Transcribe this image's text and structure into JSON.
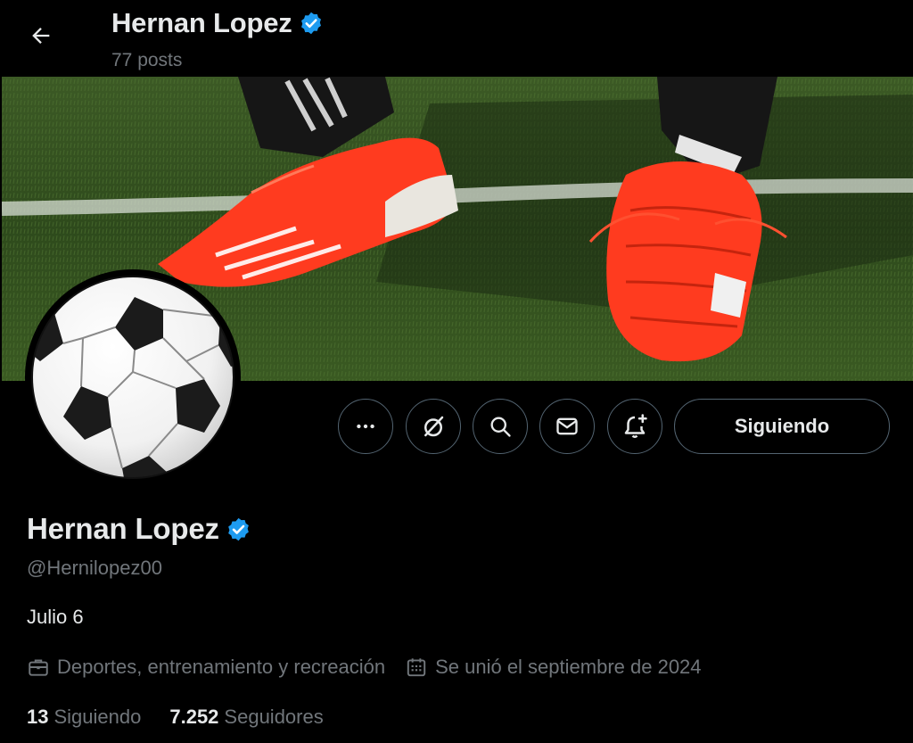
{
  "header": {
    "name": "Hernan Lopez",
    "posts": "77 posts",
    "back_icon": "arrow-left-icon",
    "verified_icon": "verified-badge-icon"
  },
  "banner": {
    "description_icon": "banner-photo"
  },
  "actions": {
    "more_icon": "more-dots-icon",
    "grok_icon": "slash-circle-icon",
    "search_icon": "search-icon",
    "message_icon": "envelope-icon",
    "notify_icon": "bell-plus-icon",
    "follow_label": "Siguiendo"
  },
  "profile": {
    "name": "Hernan Lopez",
    "handle": "@Hernilopez00",
    "bio": "Julio 6",
    "category": "Deportes, entrenamiento y recreación",
    "joined": "Se unió el septiembre de 2024",
    "following_count": "13",
    "following_label": "Siguiendo",
    "followers_count": "7.252",
    "followers_label": "Seguidores"
  },
  "colors": {
    "background": "#000000",
    "text": "#e7e9ea",
    "muted": "#71767b",
    "border": "#536471",
    "verified": "#1d9bf0",
    "boot": "#ff3b1f"
  }
}
